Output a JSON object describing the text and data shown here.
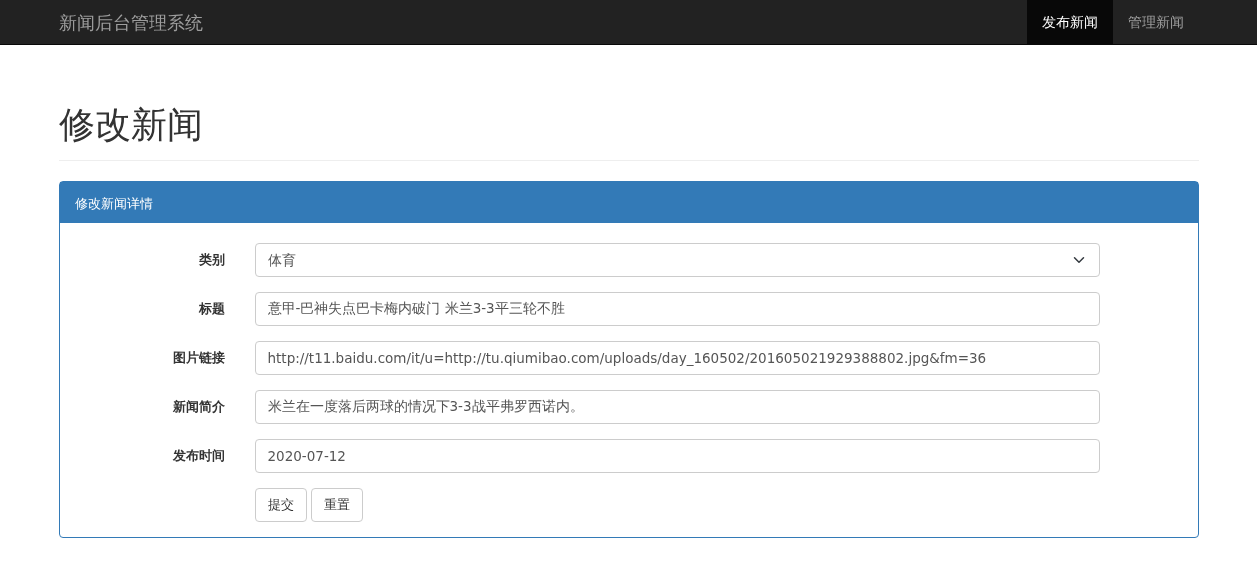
{
  "navbar": {
    "brand": "新闻后台管理系统",
    "items": [
      {
        "label": "发布新闻",
        "selected": true
      },
      {
        "label": "管理新闻",
        "selected": false
      }
    ]
  },
  "page_title": "修改新闻",
  "panel": {
    "title": "修改新闻详情",
    "fields": [
      {
        "label": "类别",
        "kind": "select",
        "value": "体育"
      },
      {
        "label": "标题",
        "kind": "text",
        "value": "意甲-巴神失点巴卡梅内破门 米兰3-3平三轮不胜"
      },
      {
        "label": "图片链接",
        "kind": "text",
        "value": "http://t11.baidu.com/it/u=http://tu.qiumibao.com/uploads/day_160502/201605021929388802.jpg&fm=36"
      },
      {
        "label": "新闻简介",
        "kind": "text",
        "value": "米兰在一度落后两球的情况下3-3战平弗罗西诺内。"
      },
      {
        "label": "发布时间",
        "kind": "text",
        "value": "2020-07-12"
      }
    ],
    "buttons": [
      "提交",
      "重置"
    ]
  }
}
